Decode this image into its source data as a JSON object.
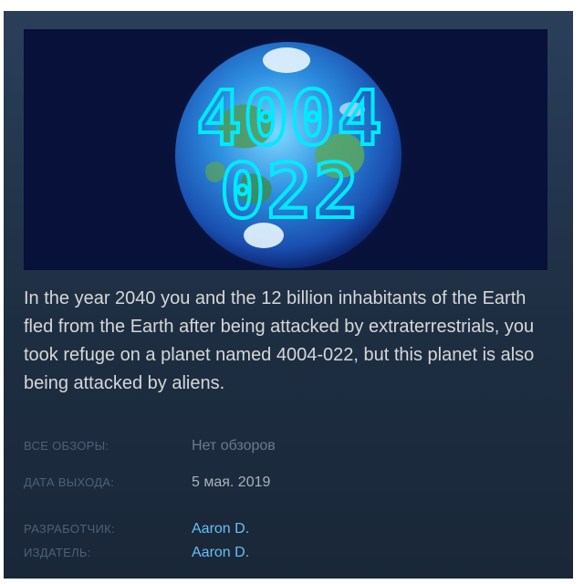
{
  "capsule": {
    "logo_text_line1": "4004",
    "logo_text_line2": "022"
  },
  "description": "In the year 2040 you and the 12 billion inhabitants of the Earth fled from the Earth after being attacked by extraterrestrials, you took refuge on a planet named 4004-022, but this planet is also being attacked by aliens.",
  "meta": {
    "reviews_label": "ВСЕ ОБЗОРЫ:",
    "reviews_value": "Нет обзоров",
    "release_label": "ДАТА ВЫХОДА:",
    "release_value": "5 мая. 2019",
    "developer_label": "РАЗРАБОТЧИК:",
    "developer_value": "Aaron D.",
    "publisher_label": "ИЗДАТЕЛЬ:",
    "publisher_value": "Aaron D."
  },
  "colors": {
    "panel_bg": "#2a3f5a",
    "link": "#66c0f4",
    "label": "#4f6177",
    "text": "#d6d7d8"
  }
}
